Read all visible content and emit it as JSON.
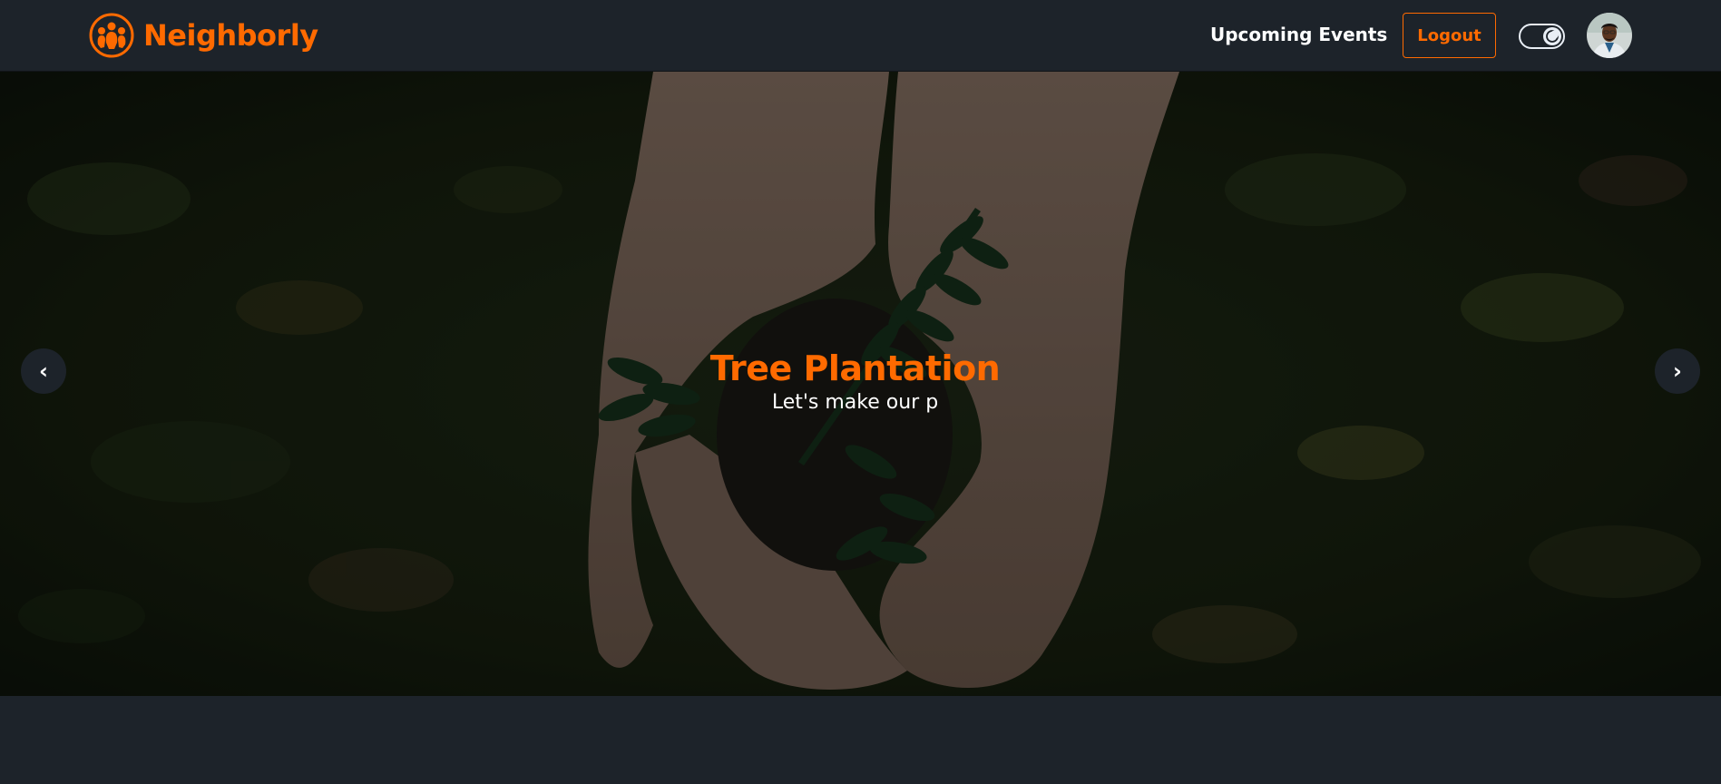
{
  "brand": {
    "name": "Neighborly",
    "icon": "community-people-icon",
    "color": "#ff6a00"
  },
  "nav": {
    "links": [
      {
        "label": "Upcoming Events"
      }
    ],
    "logout_label": "Logout",
    "theme_toggle": {
      "icon": "moon-icon",
      "state": "dark"
    },
    "avatar": {
      "icon": "user-avatar"
    }
  },
  "carousel": {
    "slide": {
      "title": "Tree Plantation",
      "subtitle": "Let's make our p"
    },
    "prev_icon": "‹",
    "next_icon": "›"
  },
  "colors": {
    "background": "#1d232a",
    "accent": "#ff6a00",
    "text": "#ffffff"
  }
}
